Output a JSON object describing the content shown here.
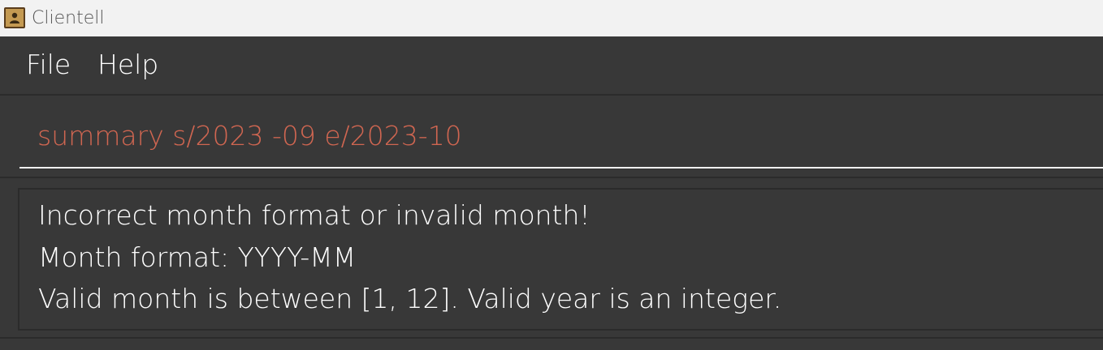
{
  "window": {
    "title": "Clientell",
    "icon": "address-book-icon"
  },
  "menu": {
    "items": [
      {
        "label": "File"
      },
      {
        "label": "Help"
      }
    ]
  },
  "command": {
    "value": "summary s/2023 -09 e/2023-10",
    "color": "#d06651"
  },
  "result": {
    "lines": [
      "Incorrect month format or invalid month!",
      "Month format: YYYY-MM",
      "Valid month is between [1, 12]. Valid year is an integer."
    ]
  },
  "colors": {
    "background": "#383838",
    "titlebar": "#f2f2f2",
    "error_text": "#d06651"
  }
}
